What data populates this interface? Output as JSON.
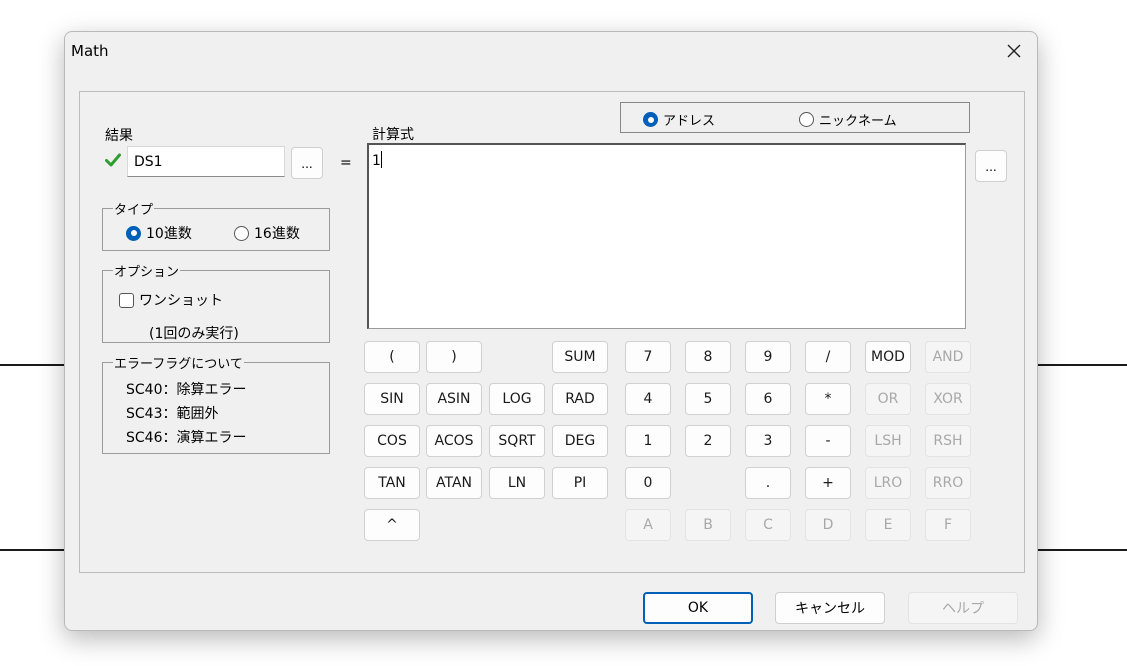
{
  "window": {
    "title": "Math"
  },
  "result": {
    "label": "結果",
    "value": "DS1",
    "browse_label": "...",
    "equals": "="
  },
  "type_group": {
    "legend": "タイプ",
    "options": [
      "10進数",
      "16進数"
    ],
    "selected": 0
  },
  "option_group": {
    "legend": "オプション",
    "oneshot_label": "ワンショット",
    "oneshot_checked": false,
    "oneshot_note": "(1回のみ実行)"
  },
  "error_group": {
    "legend": "エラーフラグについて",
    "lines": [
      "SC40：除算エラー",
      "SC43：範囲外",
      "SC46：演算エラー"
    ]
  },
  "formula": {
    "label": "計算式",
    "value": "1",
    "browse_label": "..."
  },
  "mode": {
    "options": [
      "アドレス",
      "ニックネーム"
    ],
    "selected": 0
  },
  "keypad": {
    "functions": [
      [
        "(",
        ")",
        "",
        "SUM"
      ],
      [
        "SIN",
        "ASIN",
        "LOG",
        "RAD"
      ],
      [
        "COS",
        "ACOS",
        "SQRT",
        "DEG"
      ],
      [
        "TAN",
        "ATAN",
        "LN",
        "PI"
      ],
      [
        "^",
        "",
        "",
        ""
      ]
    ],
    "digits": [
      [
        "7",
        "8",
        "9",
        "/",
        "MOD",
        "AND"
      ],
      [
        "4",
        "5",
        "6",
        "*",
        "OR",
        "XOR"
      ],
      [
        "1",
        "2",
        "3",
        "-",
        "LSH",
        "RSH"
      ],
      [
        "0",
        "",
        ".",
        "+",
        "LRO",
        "RRO"
      ],
      [
        "A",
        "B",
        "C",
        "D",
        "E",
        "F"
      ]
    ],
    "disabled": [
      "AND",
      "OR",
      "XOR",
      "LSH",
      "RSH",
      "LRO",
      "RRO",
      "A",
      "B",
      "C",
      "D",
      "E",
      "F"
    ]
  },
  "buttons": {
    "ok": "OK",
    "cancel": "キャンセル",
    "help": "ヘルプ"
  },
  "colors": {
    "accent": "#005fb8",
    "check": "#2e9e2e"
  }
}
